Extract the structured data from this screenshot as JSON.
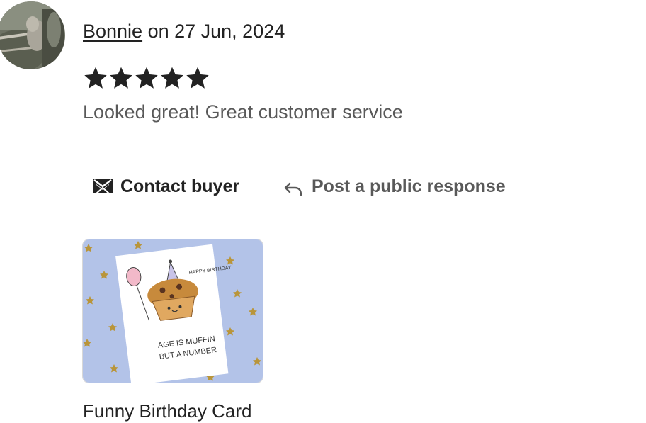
{
  "review": {
    "reviewer_name": "Bonnie",
    "date_text": " on 27 Jun, 2024",
    "rating": 5,
    "rating_max": 5,
    "text": "Looked great! Great customer service"
  },
  "actions": {
    "contact_label": "Contact buyer",
    "contact_icon": "envelope-icon",
    "respond_label": "Post a public response",
    "respond_icon": "reply-arrow-icon"
  },
  "product": {
    "title": "Funny Birthday Card",
    "card_text_top": "HAPPY BIRTHDAY!",
    "card_text_line1": "AGE IS MUFFIN",
    "card_text_line2": "BUT A NUMBER"
  },
  "colors": {
    "star": "#222222",
    "text_primary": "#222222",
    "text_secondary": "#595959",
    "thumb_background": "#b3c3e8"
  }
}
